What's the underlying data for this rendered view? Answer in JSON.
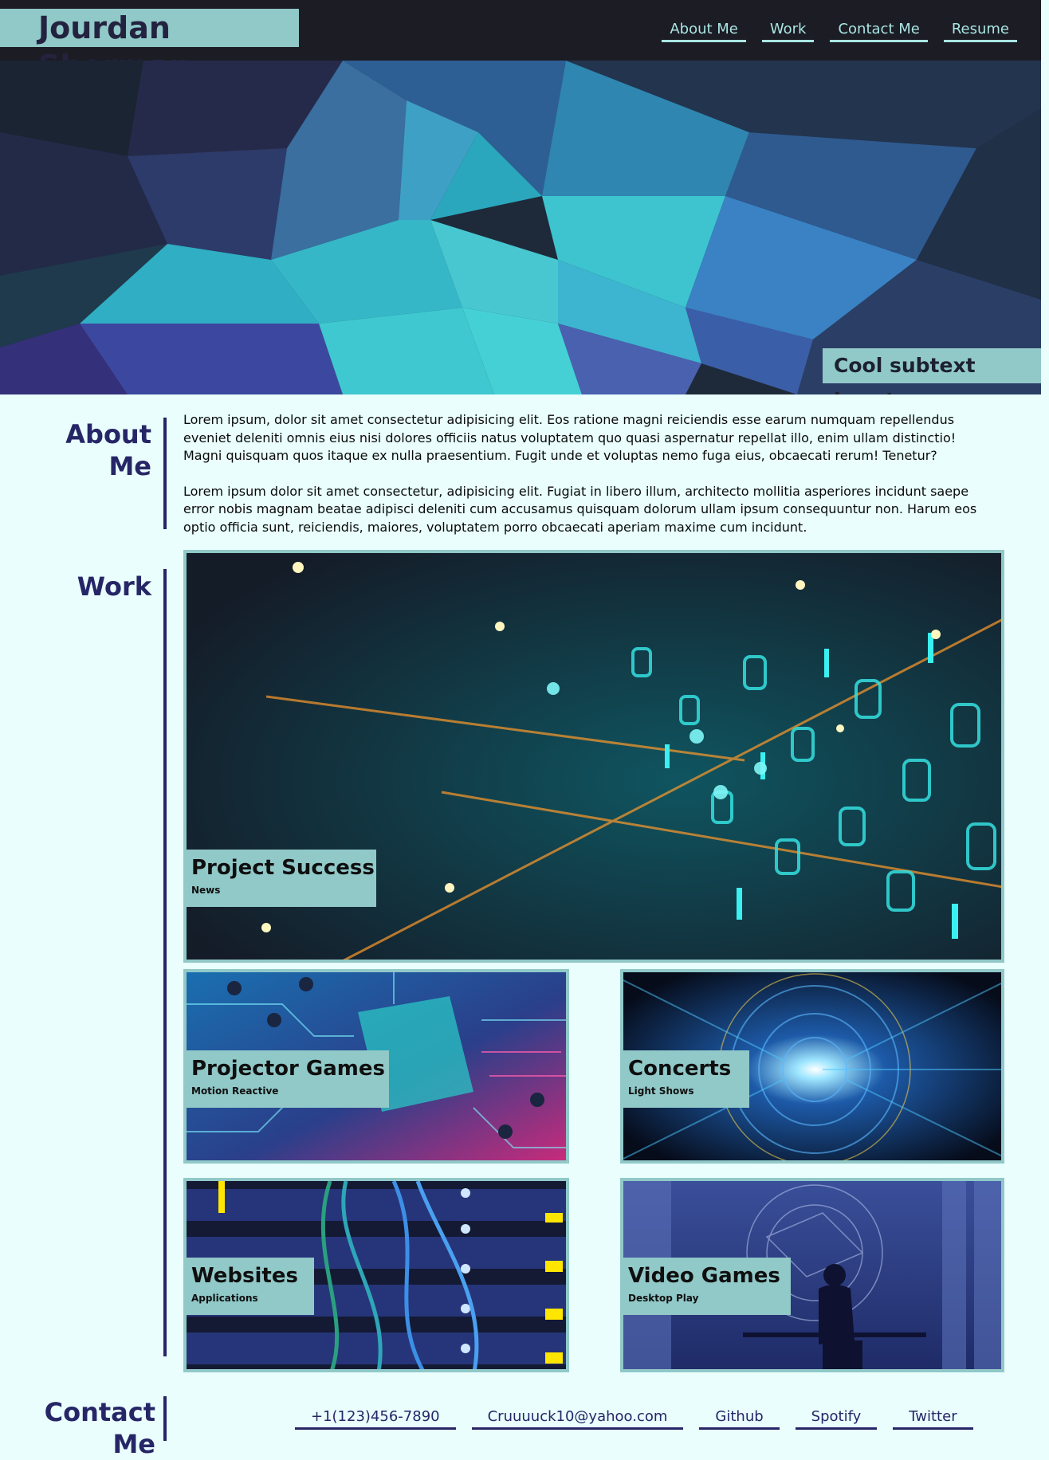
{
  "header": {
    "brand": "Jourdan Sherman",
    "nav": [
      "About Me",
      "Work",
      "Contact Me",
      "Resume"
    ]
  },
  "hero": {
    "subtext": "Cool subtext here!"
  },
  "about": {
    "title_line1": "About",
    "title_line2": "Me",
    "paragraphs": [
      "Lorem ipsum, dolor sit amet consectetur adipisicing elit. Eos ratione magni reiciendis esse earum numquam repellendus eveniet deleniti omnis eius nisi dolores officiis natus voluptatem quo quasi aspernatur repellat illo, enim ullam distinctio! Magni quisquam quos itaque ex nulla praesentium. Fugit unde et voluptas nemo fuga eius, obcaecati rerum! Tenetur?",
      "Lorem ipsum dolor sit amet consectetur, adipisicing elit. Fugiat in libero illum, architecto mollitia asperiores incidunt saepe error nobis magnam beatae adipisci deleniti cum accusamus quisquam dolorum ullam ipsum consequuntur non. Harum eos optio officia sunt, reiciendis, maiores, voluptatem porro obcaecati aperiam maxime cum incidunt."
    ]
  },
  "work": {
    "title": "Work",
    "projects": [
      {
        "title": "Project Success",
        "subtitle": "News"
      },
      {
        "title": "Projector Games",
        "subtitle": "Motion Reactive"
      },
      {
        "title": "Concerts",
        "subtitle": "Light Shows"
      },
      {
        "title": "Websites",
        "subtitle": "Applications"
      },
      {
        "title": "Video Games",
        "subtitle": "Desktop Play"
      }
    ]
  },
  "contact": {
    "title": "Contact Me",
    "links": [
      "+1(123)456-7890",
      "Cruuuuck10@yahoo.com",
      "Github",
      "Spotify",
      "Twitter"
    ]
  },
  "colors": {
    "page_bg": "#e9fefd",
    "header_bg": "#1c1c24",
    "accent": "#91c8c8",
    "heading": "#262667",
    "nav_link": "#a9e5e3"
  }
}
